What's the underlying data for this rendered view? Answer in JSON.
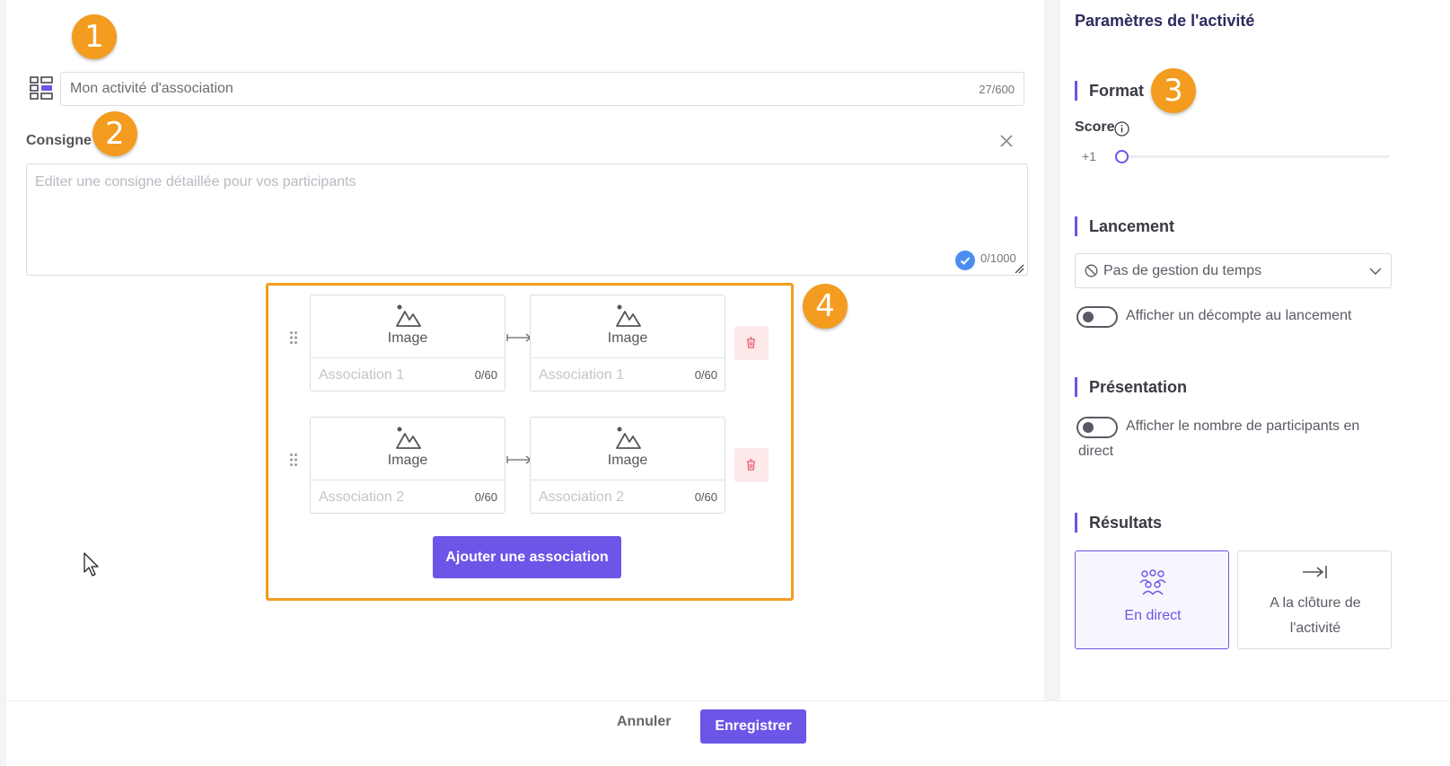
{
  "editor": {
    "title_value": "Mon activité d'association",
    "title_count": "27/600",
    "consigne_label": "Consigne",
    "consigne_placeholder": "Editer une consigne détaillée pour vos participants",
    "consigne_count": "0/1000",
    "image_label": "Image",
    "associations": [
      {
        "left_name": "Association 1",
        "left_count": "0/60",
        "right_name": "Association 1",
        "right_count": "0/60"
      },
      {
        "left_name": "Association 2",
        "left_count": "0/60",
        "right_name": "Association 2",
        "right_count": "0/60"
      }
    ],
    "add_button": "Ajouter une association"
  },
  "badges": [
    "1",
    "2",
    "3",
    "4"
  ],
  "settings": {
    "title": "Paramètres de l'activité",
    "format": {
      "heading": "Format",
      "score_label": "Score",
      "score_value": "+1"
    },
    "lancement": {
      "heading": "Lancement",
      "time_select": "Pas de gestion du temps",
      "countdown_toggle": "Afficher un décompte au lancement"
    },
    "presentation": {
      "heading": "Présentation",
      "participants_toggle": "Afficher le nombre de participants en direct"
    },
    "resultats": {
      "heading": "Résultats",
      "option_live": "En direct",
      "option_close": "A la clôture de l'activité"
    }
  },
  "footer": {
    "cancel": "Annuler",
    "save": "Enregistrer"
  },
  "colors": {
    "accent": "#6b56e8",
    "badge": "#f39c1f",
    "frame": "#f39c1f"
  },
  "icons": [
    "grid-icon",
    "close-icon",
    "image-icon",
    "drag-handle-icon",
    "arrow-icon",
    "trash-icon",
    "info-icon",
    "ban-icon",
    "chevron-down-icon",
    "group-icon",
    "arrow-to-end-icon",
    "cursor-icon"
  ]
}
